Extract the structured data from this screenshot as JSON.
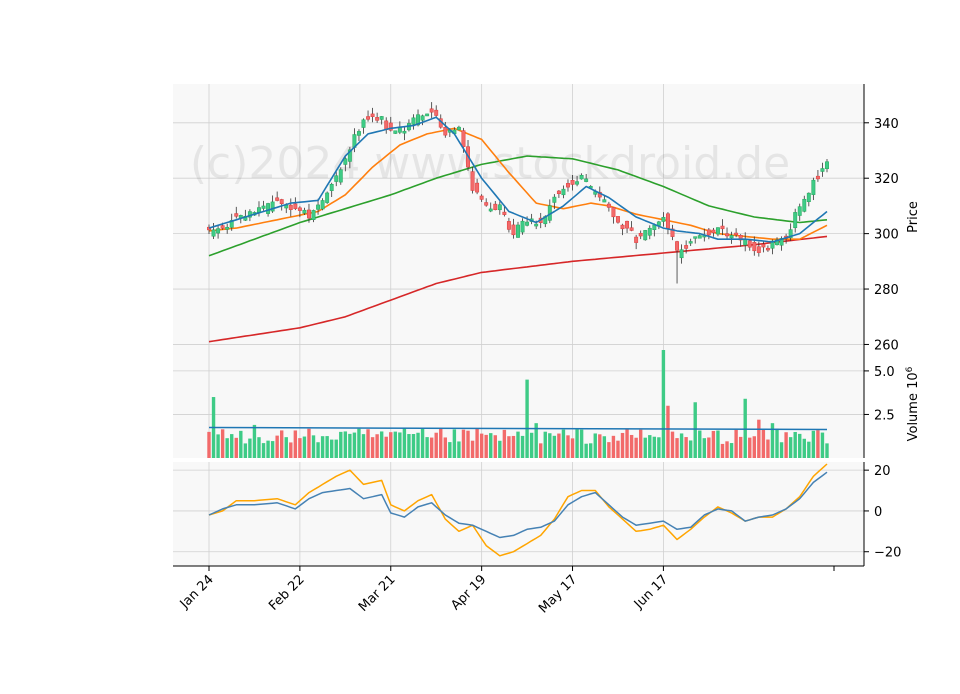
{
  "chart_data": {
    "type": "candlestick",
    "watermark": "(c)2024 www.stockdroid.de",
    "colors": {
      "up": "#26a65b",
      "up_fill": "#3ecb86",
      "down": "#e03a3a",
      "down_fill": "#f26a6a",
      "sma_short": "#1f77b4",
      "sma_mid": "#ff7f0e",
      "sma_long": "#2ca02c",
      "sma_200": "#d62728",
      "osc_1": "#4682b4",
      "osc_2": "#ffa500",
      "volume_avg": "#1f77b4",
      "panel_bg": "#f8f8f8",
      "grid": "#d0d0d0"
    },
    "x_tick_labels": [
      "Jan 24",
      "Feb 22",
      "Mar 21",
      "Apr 19",
      "May 17",
      "Jun 17"
    ],
    "price_panel": {
      "ylabel": "Price",
      "ylim": [
        258,
        354
      ],
      "y_ticks": [
        260,
        280,
        300,
        320,
        340
      ],
      "anchors": {
        "close": [
          [
            0,
            300
          ],
          [
            3,
            303
          ],
          [
            6,
            305
          ],
          [
            10,
            308
          ],
          [
            15,
            311
          ],
          [
            19,
            309
          ],
          [
            22,
            306
          ],
          [
            25,
            312
          ],
          [
            28,
            320
          ],
          [
            31,
            331
          ],
          [
            34,
            342
          ],
          [
            38,
            341
          ],
          [
            40,
            336
          ],
          [
            43,
            338
          ],
          [
            46,
            342
          ],
          [
            49,
            345
          ],
          [
            52,
            337
          ],
          [
            55,
            338
          ],
          [
            58,
            317
          ],
          [
            61,
            309
          ],
          [
            64,
            309
          ],
          [
            67,
            300
          ],
          [
            70,
            305
          ],
          [
            73,
            303
          ],
          [
            76,
            314
          ],
          [
            79,
            318
          ],
          [
            82,
            320
          ],
          [
            85,
            315
          ],
          [
            88,
            309
          ],
          [
            91,
            303
          ],
          [
            94,
            298
          ],
          [
            97,
            303
          ],
          [
            100,
            307
          ],
          [
            103,
            293
          ],
          [
            106,
            297
          ],
          [
            109,
            300
          ],
          [
            112,
            302
          ],
          [
            115,
            299
          ],
          [
            118,
            297
          ],
          [
            121,
            294
          ],
          [
            124,
            296
          ],
          [
            127,
            299
          ],
          [
            130,
            310
          ],
          [
            133,
            318
          ],
          [
            136,
            326
          ]
        ],
        "sma_short": [
          [
            0,
            302
          ],
          [
            6,
            305
          ],
          [
            12,
            308
          ],
          [
            18,
            311
          ],
          [
            24,
            312
          ],
          [
            30,
            328
          ],
          [
            35,
            336
          ],
          [
            40,
            338
          ],
          [
            45,
            339
          ],
          [
            50,
            342
          ],
          [
            54,
            336
          ],
          [
            60,
            320
          ],
          [
            66,
            308
          ],
          [
            72,
            304
          ],
          [
            78,
            310
          ],
          [
            83,
            317
          ],
          [
            88,
            313
          ],
          [
            94,
            306
          ],
          [
            100,
            302
          ],
          [
            103,
            301
          ],
          [
            108,
            300
          ],
          [
            112,
            298
          ],
          [
            118,
            298
          ],
          [
            124,
            297
          ],
          [
            130,
            300
          ],
          [
            136,
            308
          ]
        ],
        "sma_mid": [
          [
            0,
            301
          ],
          [
            6,
            302
          ],
          [
            12,
            304
          ],
          [
            18,
            306
          ],
          [
            24,
            308
          ],
          [
            30,
            314
          ],
          [
            36,
            324
          ],
          [
            42,
            332
          ],
          [
            48,
            336
          ],
          [
            54,
            338
          ],
          [
            60,
            334
          ],
          [
            66,
            322
          ],
          [
            72,
            311
          ],
          [
            78,
            309
          ],
          [
            84,
            311
          ],
          [
            88,
            310
          ],
          [
            94,
            307
          ],
          [
            100,
            305
          ],
          [
            106,
            303
          ],
          [
            112,
            300
          ],
          [
            118,
            299
          ],
          [
            124,
            298
          ],
          [
            130,
            298
          ],
          [
            136,
            303
          ]
        ],
        "sma_long": [
          [
            0,
            292
          ],
          [
            10,
            298
          ],
          [
            20,
            304
          ],
          [
            30,
            309
          ],
          [
            40,
            314
          ],
          [
            50,
            320
          ],
          [
            60,
            325
          ],
          [
            70,
            328
          ],
          [
            80,
            327
          ],
          [
            90,
            323
          ],
          [
            100,
            317
          ],
          [
            110,
            310
          ],
          [
            120,
            306
          ],
          [
            130,
            304
          ],
          [
            136,
            305
          ]
        ],
        "sma_200": [
          [
            0,
            261
          ],
          [
            20,
            266
          ],
          [
            30,
            270
          ],
          [
            40,
            276
          ],
          [
            50,
            282
          ],
          [
            60,
            286
          ],
          [
            70,
            288
          ],
          [
            80,
            290
          ],
          [
            100,
            293
          ],
          [
            120,
            296
          ],
          [
            136,
            299
          ]
        ]
      }
    },
    "volume_panel": {
      "ylabel": "Volume  10^6",
      "ylim": [
        0,
        6.2
      ],
      "y_ticks": [
        2.5,
        5.0
      ],
      "y_tick_labels": [
        "2.5",
        "5.0"
      ],
      "avg_level": 1.75,
      "spikes": [
        [
          1,
          3.5
        ],
        [
          10,
          1.9
        ],
        [
          29,
          1.5
        ],
        [
          48,
          1.2
        ],
        [
          70,
          4.5
        ],
        [
          72,
          2.0
        ],
        [
          100,
          6.2
        ],
        [
          101,
          3.0
        ],
        [
          107,
          3.2
        ],
        [
          118,
          3.4
        ],
        [
          121,
          2.2
        ],
        [
          124,
          2.0
        ],
        [
          134,
          1.6
        ]
      ]
    },
    "oscillator_panel": {
      "ylim": [
        -27,
        24
      ],
      "y_ticks": [
        -20,
        0,
        20
      ],
      "y_tick_labels": [
        "−20",
        "0",
        "20"
      ],
      "anchors_1": [
        [
          0,
          -2
        ],
        [
          3,
          1
        ],
        [
          6,
          3
        ],
        [
          10,
          3
        ],
        [
          15,
          4
        ],
        [
          19,
          1
        ],
        [
          22,
          6
        ],
        [
          25,
          9
        ],
        [
          28,
          10
        ],
        [
          31,
          11
        ],
        [
          34,
          6
        ],
        [
          38,
          8
        ],
        [
          40,
          -1
        ],
        [
          43,
          -3
        ],
        [
          46,
          2
        ],
        [
          49,
          4
        ],
        [
          52,
          -2
        ],
        [
          55,
          -6
        ],
        [
          58,
          -7
        ],
        [
          61,
          -10
        ],
        [
          64,
          -13
        ],
        [
          67,
          -12
        ],
        [
          70,
          -9
        ],
        [
          73,
          -8
        ],
        [
          76,
          -5
        ],
        [
          79,
          3
        ],
        [
          82,
          7
        ],
        [
          85,
          9
        ],
        [
          88,
          3
        ],
        [
          91,
          -3
        ],
        [
          94,
          -7
        ],
        [
          97,
          -6
        ],
        [
          100,
          -5
        ],
        [
          103,
          -9
        ],
        [
          106,
          -8
        ],
        [
          109,
          -2
        ],
        [
          112,
          1
        ],
        [
          115,
          0
        ],
        [
          118,
          -5
        ],
        [
          121,
          -3
        ],
        [
          124,
          -2
        ],
        [
          127,
          1
        ],
        [
          130,
          6
        ],
        [
          133,
          14
        ],
        [
          136,
          19
        ]
      ],
      "anchors_2": [
        [
          0,
          -2
        ],
        [
          3,
          0
        ],
        [
          6,
          5
        ],
        [
          10,
          5
        ],
        [
          15,
          6
        ],
        [
          19,
          3
        ],
        [
          22,
          9
        ],
        [
          25,
          13
        ],
        [
          28,
          17
        ],
        [
          31,
          20
        ],
        [
          34,
          13
        ],
        [
          38,
          15
        ],
        [
          40,
          3
        ],
        [
          43,
          0
        ],
        [
          46,
          5
        ],
        [
          49,
          8
        ],
        [
          52,
          -4
        ],
        [
          55,
          -10
        ],
        [
          58,
          -7
        ],
        [
          61,
          -17
        ],
        [
          64,
          -22
        ],
        [
          67,
          -20
        ],
        [
          70,
          -16
        ],
        [
          73,
          -12
        ],
        [
          76,
          -4
        ],
        [
          79,
          7
        ],
        [
          82,
          10
        ],
        [
          85,
          10
        ],
        [
          88,
          2
        ],
        [
          91,
          -4
        ],
        [
          94,
          -10
        ],
        [
          97,
          -9
        ],
        [
          100,
          -7
        ],
        [
          103,
          -14
        ],
        [
          106,
          -9
        ],
        [
          109,
          -3
        ],
        [
          112,
          2
        ],
        [
          115,
          -1
        ],
        [
          118,
          -5
        ],
        [
          121,
          -3
        ],
        [
          124,
          -3
        ],
        [
          127,
          1
        ],
        [
          130,
          7
        ],
        [
          133,
          17
        ],
        [
          136,
          23
        ]
      ]
    }
  }
}
